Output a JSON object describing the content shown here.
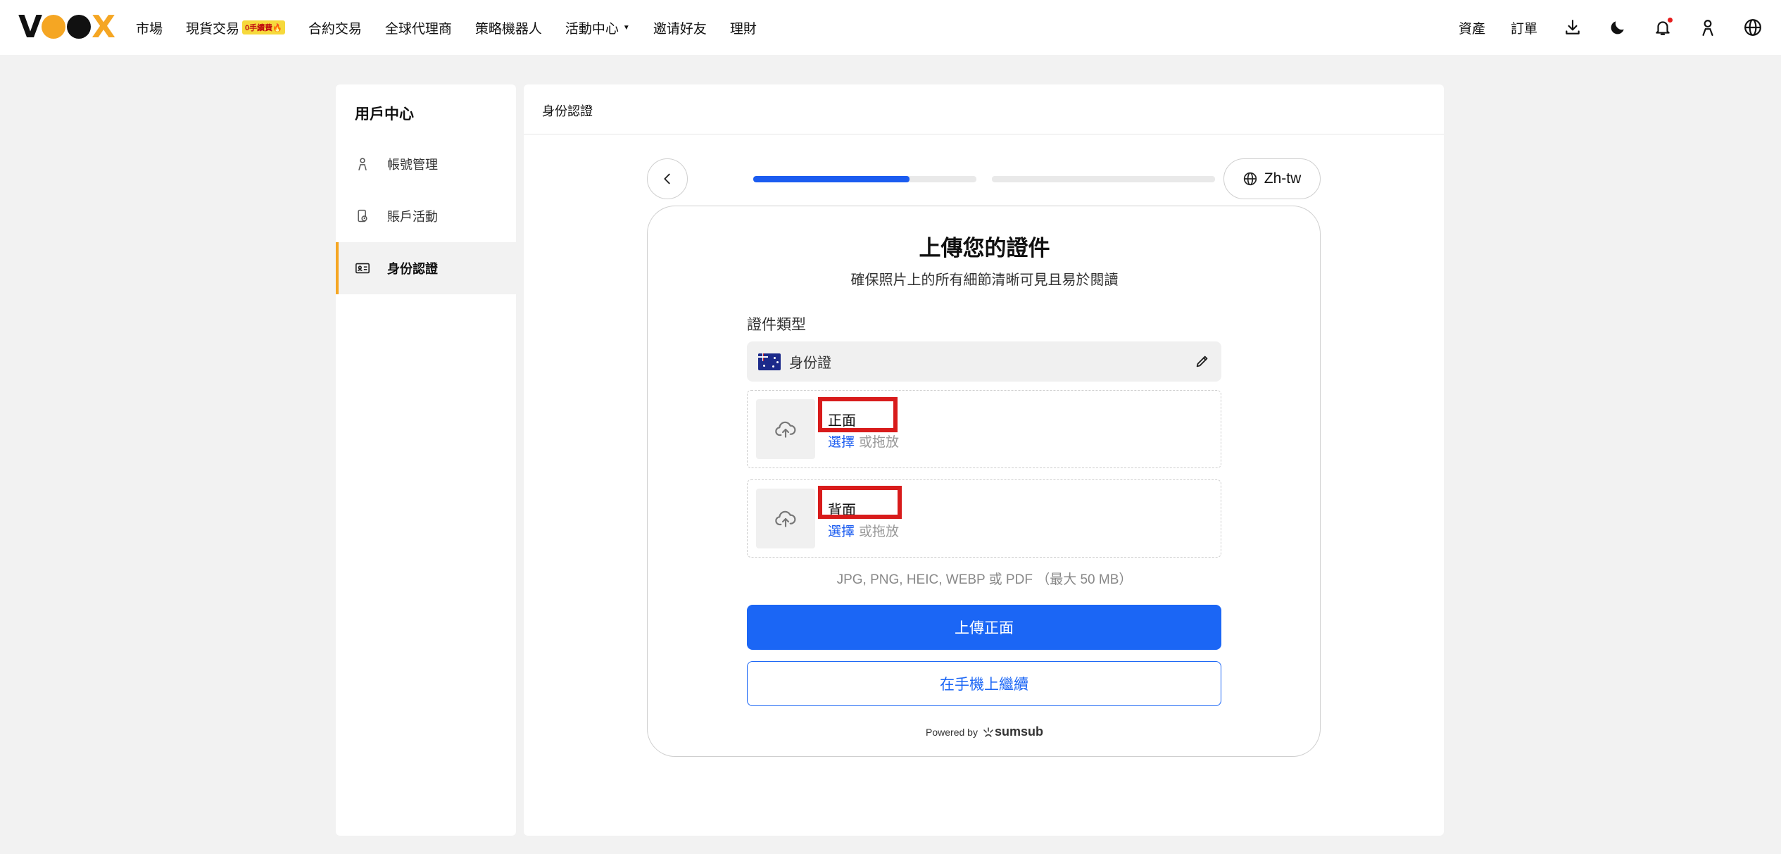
{
  "nav": {
    "logo": "VOOX",
    "links": [
      "市場",
      "現貨交易",
      "合約交易",
      "全球代理商",
      "策略機器人",
      "活動中心",
      "邀请好友",
      "理財"
    ],
    "spot_badge": "0手續費🔥",
    "right_links": [
      "資產",
      "訂單"
    ],
    "icons": [
      "download-icon",
      "moon-icon",
      "bell-icon",
      "user-icon",
      "globe-icon"
    ]
  },
  "sidebar": {
    "title": "用戶中心",
    "items": [
      {
        "label": "帳號管理",
        "icon": "person-icon"
      },
      {
        "label": "賬戶活動",
        "icon": "activity-icon"
      },
      {
        "label": "身份認證",
        "icon": "id-card-icon",
        "active": true
      }
    ]
  },
  "main": {
    "title": "身份認證"
  },
  "kyc": {
    "progress_step1": 0.7,
    "progress_step2": 0.0,
    "language": "Zh-tw",
    "title": "上傳您的證件",
    "subtitle": "確保照片上的所有細節清晰可見且易於閱讀",
    "doc_type_label": "證件類型",
    "doc_type_value": "身份證",
    "front": {
      "name": "正面",
      "select": "選擇",
      "hint": "或拖放"
    },
    "back": {
      "name": "背面",
      "select": "選擇",
      "hint": "或拖放"
    },
    "formats": "JPG, PNG, HEIC, WEBP 或 PDF （最大 50 MB）",
    "primary_button": "上傳正面",
    "secondary_button": "在手機上繼續",
    "powered_by": "Powered by",
    "brand": "sumsub"
  },
  "colors": {
    "accent": "#f5a623",
    "primary": "#1b66f5",
    "highlight": "#d81b1b"
  }
}
